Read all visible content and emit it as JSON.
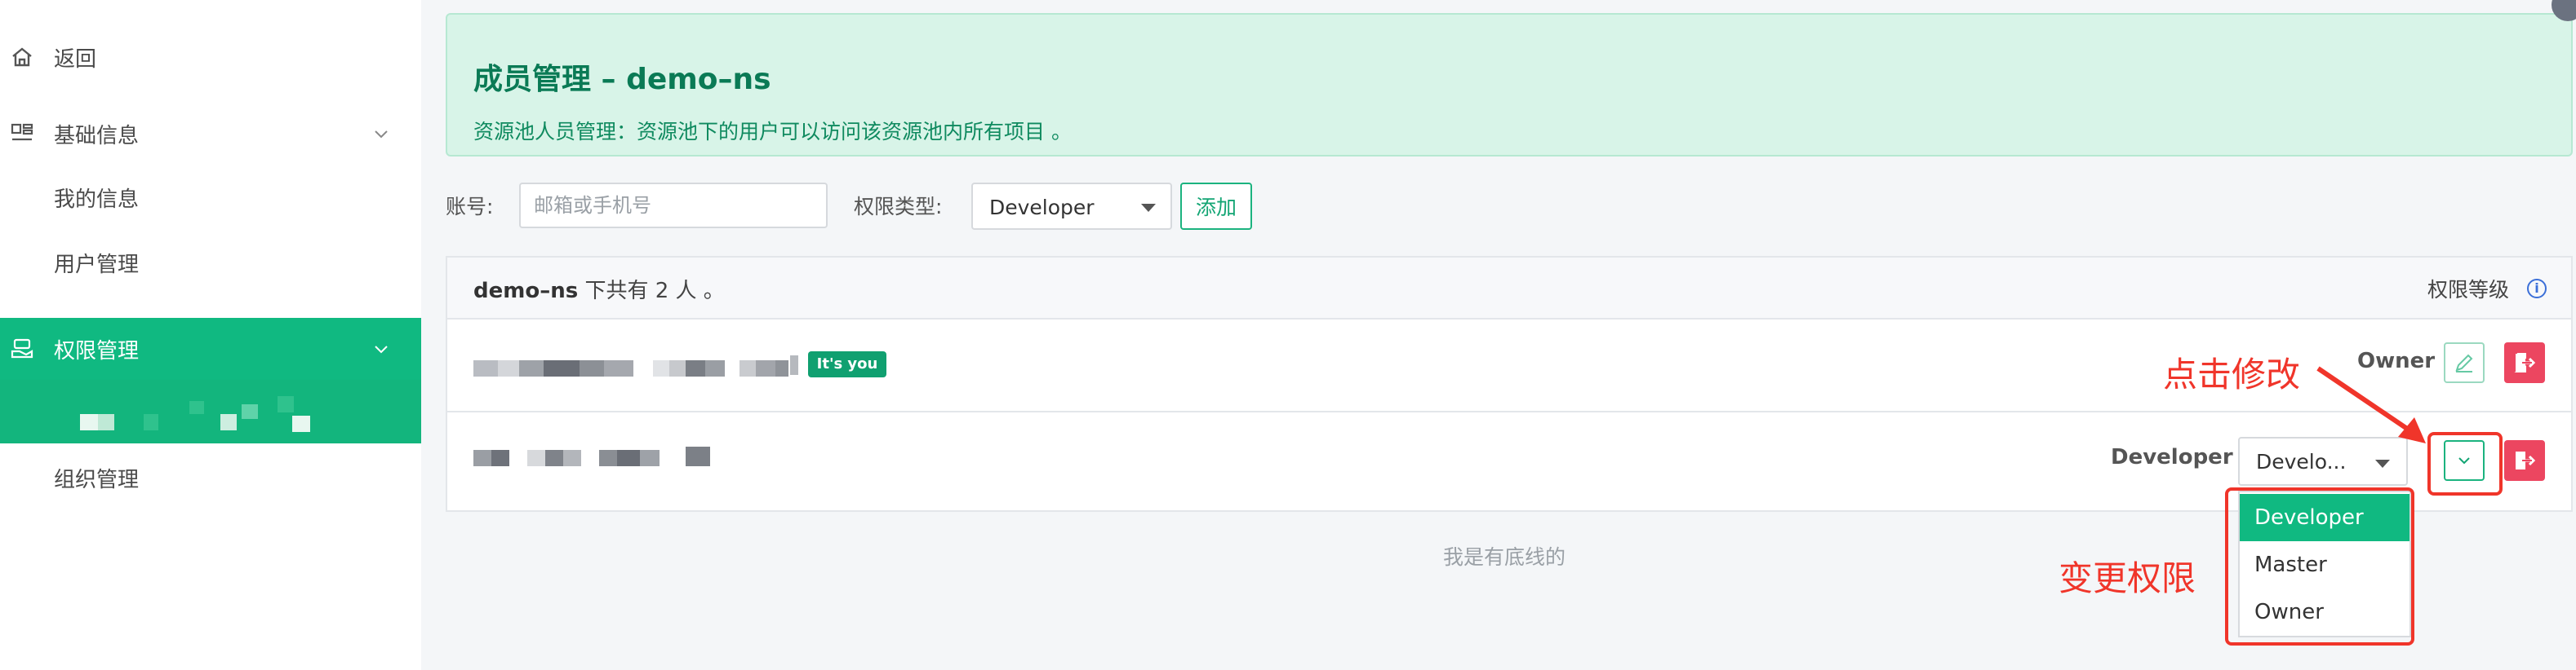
{
  "sidebar": {
    "back": "返回",
    "basic_info": "基础信息",
    "my_info": "我的信息",
    "user_mgmt": "用户管理",
    "permission_mgmt": "权限管理",
    "org_mgmt": "组织管理"
  },
  "banner": {
    "title": "成员管理 – demo–ns",
    "desc": "资源池人员管理：资源池下的用户可以访问该资源池内所有项目 。"
  },
  "form": {
    "account_label": "账号:",
    "account_placeholder": "邮箱或手机号",
    "perm_type_label": "权限类型:",
    "perm_type_value": "Developer",
    "add_label": "添加"
  },
  "table": {
    "ns": "demo–ns",
    "summary_middle": "下共有",
    "count": "2",
    "summary_tail": "人 。",
    "level_header": "权限等级",
    "rows": [
      {
        "badge": "It's you",
        "role": "Owner"
      },
      {
        "role": "Developer",
        "select_value": "Develo..."
      }
    ]
  },
  "dropdown": {
    "options": [
      "Developer",
      "Master",
      "Owner"
    ],
    "selected": "Developer"
  },
  "footer_note": "我是有底线的",
  "annotations": {
    "click_edit": "点击修改",
    "change_perm": "变更权限"
  },
  "colors": {
    "accent": "#10b981",
    "danger": "#ec4660",
    "annotation": "#f0352a",
    "banner_bg": "#d8f4e8"
  },
  "icons": {
    "back": "home-icon",
    "basic_info": "layout-icon",
    "permission": "hand-key-icon",
    "edit": "pencil-icon",
    "exit": "exit-icon",
    "info": "info-icon",
    "toggle": "chevron-down-icon"
  }
}
